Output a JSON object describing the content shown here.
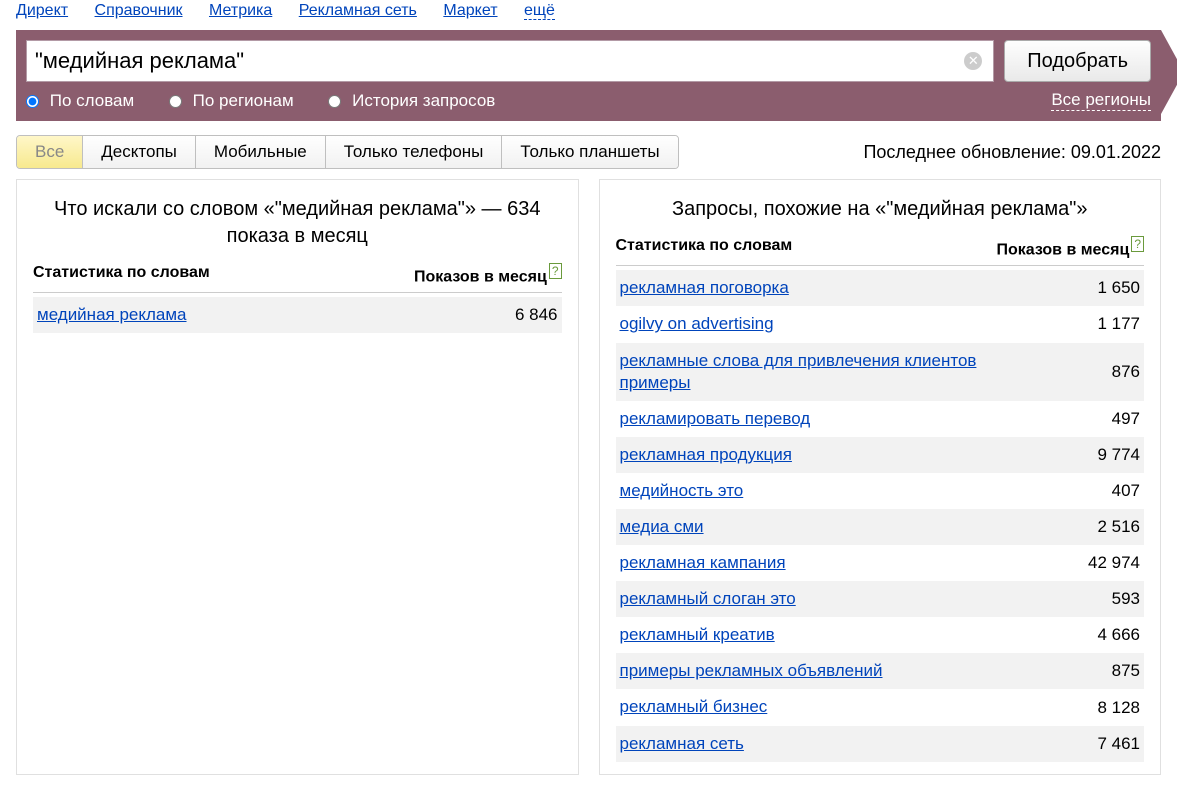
{
  "nav": {
    "items": [
      "Директ",
      "Справочник",
      "Метрика",
      "Рекламная сеть",
      "Маркет"
    ],
    "more": "ещё"
  },
  "search": {
    "value": "\"медийная реклама\"",
    "submit": "Подобрать",
    "clear_icon_label": "clear"
  },
  "filters": {
    "options": [
      "По словам",
      "По регионам",
      "История запросов"
    ],
    "selected": 0,
    "regions_link": "Все регионы"
  },
  "tabs": {
    "items": [
      "Все",
      "Десктопы",
      "Мобильные",
      "Только телефоны",
      "Только планшеты"
    ],
    "active": 0
  },
  "last_update_label": "Последнее обновление: 09.01.2022",
  "left_panel": {
    "title": "Что искали со словом «\"медийная реклама\"» — 634 показа в месяц",
    "col1": "Статистика по словам",
    "col2": "Показов в месяц",
    "rows": [
      {
        "term": "медийная реклама",
        "shows": "6 846"
      }
    ]
  },
  "right_panel": {
    "title": "Запросы, похожие на «\"медийная реклама\"»",
    "col1": "Статистика по словам",
    "col2": "Показов в месяц",
    "rows": [
      {
        "term": "рекламная поговорка",
        "shows": "1 650"
      },
      {
        "term": "ogilvy on advertising",
        "shows": "1 177"
      },
      {
        "term": "рекламные слова для привлечения клиентов примеры",
        "shows": "876"
      },
      {
        "term": "рекламировать перевод",
        "shows": "497"
      },
      {
        "term": "рекламная продукция",
        "shows": "9 774"
      },
      {
        "term": "медийность это",
        "shows": "407"
      },
      {
        "term": "медиа сми",
        "shows": "2 516"
      },
      {
        "term": "рекламная кампания",
        "shows": "42 974"
      },
      {
        "term": "рекламный слоган это",
        "shows": "593"
      },
      {
        "term": "рекламный креатив",
        "shows": "4 666"
      },
      {
        "term": "примеры рекламных объявлений",
        "shows": "875"
      },
      {
        "term": "рекламный бизнес",
        "shows": "8 128"
      },
      {
        "term": "рекламная сеть",
        "shows": "7 461"
      }
    ]
  },
  "help_icon_text": "?"
}
